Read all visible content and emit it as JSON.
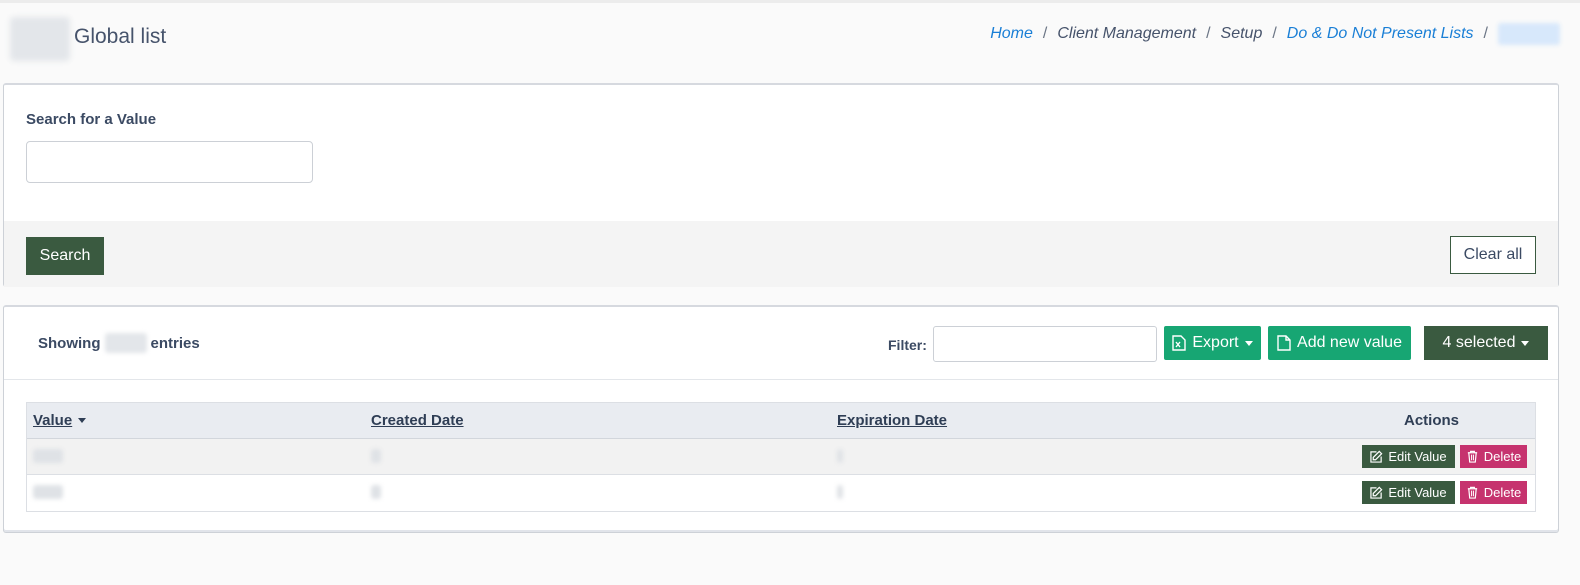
{
  "header": {
    "title": "Global list",
    "breadcrumb": [
      {
        "label": "Home",
        "link": true
      },
      {
        "label": "Client Management",
        "link": false
      },
      {
        "label": "Setup",
        "link": false
      },
      {
        "label": "Do & Do Not Present Lists",
        "link": true
      }
    ],
    "separator": "/"
  },
  "search_panel": {
    "label": "Search for a Value",
    "input_value": "",
    "search_button": "Search",
    "clear_button": "Clear all"
  },
  "list_panel": {
    "showing_prefix": "Showing",
    "showing_suffix": "entries",
    "filter_label": "Filter:",
    "filter_value": "",
    "export_button": "Export",
    "add_button": "Add new value",
    "selected_button": "4 selected",
    "columns": [
      "Value",
      "Created Date",
      "Expiration Date",
      "Actions"
    ],
    "row_actions": {
      "edit": "Edit Value",
      "delete": "Delete"
    },
    "row_count": 2
  },
  "colors": {
    "primary_dark_green": "#3a5a40",
    "accent_green": "#17a673",
    "delete_pink": "#c6336e",
    "link_blue": "#1a7fd6"
  }
}
